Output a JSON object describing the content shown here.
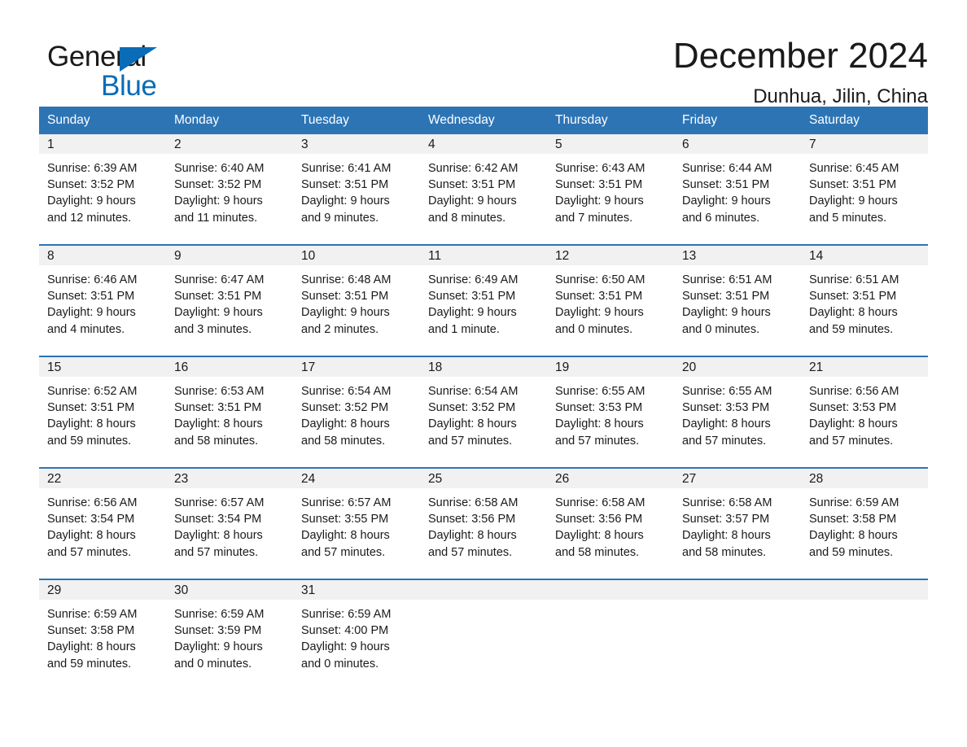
{
  "brand": {
    "name_part1": "General",
    "name_part2": "Blue",
    "logo_icon": "triangle-flag-icon",
    "accent_color": "#0a6cb6"
  },
  "header": {
    "month_title": "December 2024",
    "location": "Dunhua, Jilin, China"
  },
  "theme": {
    "header_blue": "#2d74b5",
    "daynum_band": "#f1f1f1",
    "text": "#1a1a1a"
  },
  "calendar": {
    "weekday_headers": [
      "Sunday",
      "Monday",
      "Tuesday",
      "Wednesday",
      "Thursday",
      "Friday",
      "Saturday"
    ],
    "weeks": [
      [
        {
          "day": "1",
          "sunrise": "Sunrise: 6:39 AM",
          "sunset": "Sunset: 3:52 PM",
          "daylight_line1": "Daylight: 9 hours",
          "daylight_line2": "and 12 minutes."
        },
        {
          "day": "2",
          "sunrise": "Sunrise: 6:40 AM",
          "sunset": "Sunset: 3:52 PM",
          "daylight_line1": "Daylight: 9 hours",
          "daylight_line2": "and 11 minutes."
        },
        {
          "day": "3",
          "sunrise": "Sunrise: 6:41 AM",
          "sunset": "Sunset: 3:51 PM",
          "daylight_line1": "Daylight: 9 hours",
          "daylight_line2": "and 9 minutes."
        },
        {
          "day": "4",
          "sunrise": "Sunrise: 6:42 AM",
          "sunset": "Sunset: 3:51 PM",
          "daylight_line1": "Daylight: 9 hours",
          "daylight_line2": "and 8 minutes."
        },
        {
          "day": "5",
          "sunrise": "Sunrise: 6:43 AM",
          "sunset": "Sunset: 3:51 PM",
          "daylight_line1": "Daylight: 9 hours",
          "daylight_line2": "and 7 minutes."
        },
        {
          "day": "6",
          "sunrise": "Sunrise: 6:44 AM",
          "sunset": "Sunset: 3:51 PM",
          "daylight_line1": "Daylight: 9 hours",
          "daylight_line2": "and 6 minutes."
        },
        {
          "day": "7",
          "sunrise": "Sunrise: 6:45 AM",
          "sunset": "Sunset: 3:51 PM",
          "daylight_line1": "Daylight: 9 hours",
          "daylight_line2": "and 5 minutes."
        }
      ],
      [
        {
          "day": "8",
          "sunrise": "Sunrise: 6:46 AM",
          "sunset": "Sunset: 3:51 PM",
          "daylight_line1": "Daylight: 9 hours",
          "daylight_line2": "and 4 minutes."
        },
        {
          "day": "9",
          "sunrise": "Sunrise: 6:47 AM",
          "sunset": "Sunset: 3:51 PM",
          "daylight_line1": "Daylight: 9 hours",
          "daylight_line2": "and 3 minutes."
        },
        {
          "day": "10",
          "sunrise": "Sunrise: 6:48 AM",
          "sunset": "Sunset: 3:51 PM",
          "daylight_line1": "Daylight: 9 hours",
          "daylight_line2": "and 2 minutes."
        },
        {
          "day": "11",
          "sunrise": "Sunrise: 6:49 AM",
          "sunset": "Sunset: 3:51 PM",
          "daylight_line1": "Daylight: 9 hours",
          "daylight_line2": "and 1 minute."
        },
        {
          "day": "12",
          "sunrise": "Sunrise: 6:50 AM",
          "sunset": "Sunset: 3:51 PM",
          "daylight_line1": "Daylight: 9 hours",
          "daylight_line2": "and 0 minutes."
        },
        {
          "day": "13",
          "sunrise": "Sunrise: 6:51 AM",
          "sunset": "Sunset: 3:51 PM",
          "daylight_line1": "Daylight: 9 hours",
          "daylight_line2": "and 0 minutes."
        },
        {
          "day": "14",
          "sunrise": "Sunrise: 6:51 AM",
          "sunset": "Sunset: 3:51 PM",
          "daylight_line1": "Daylight: 8 hours",
          "daylight_line2": "and 59 minutes."
        }
      ],
      [
        {
          "day": "15",
          "sunrise": "Sunrise: 6:52 AM",
          "sunset": "Sunset: 3:51 PM",
          "daylight_line1": "Daylight: 8 hours",
          "daylight_line2": "and 59 minutes."
        },
        {
          "day": "16",
          "sunrise": "Sunrise: 6:53 AM",
          "sunset": "Sunset: 3:51 PM",
          "daylight_line1": "Daylight: 8 hours",
          "daylight_line2": "and 58 minutes."
        },
        {
          "day": "17",
          "sunrise": "Sunrise: 6:54 AM",
          "sunset": "Sunset: 3:52 PM",
          "daylight_line1": "Daylight: 8 hours",
          "daylight_line2": "and 58 minutes."
        },
        {
          "day": "18",
          "sunrise": "Sunrise: 6:54 AM",
          "sunset": "Sunset: 3:52 PM",
          "daylight_line1": "Daylight: 8 hours",
          "daylight_line2": "and 57 minutes."
        },
        {
          "day": "19",
          "sunrise": "Sunrise: 6:55 AM",
          "sunset": "Sunset: 3:53 PM",
          "daylight_line1": "Daylight: 8 hours",
          "daylight_line2": "and 57 minutes."
        },
        {
          "day": "20",
          "sunrise": "Sunrise: 6:55 AM",
          "sunset": "Sunset: 3:53 PM",
          "daylight_line1": "Daylight: 8 hours",
          "daylight_line2": "and 57 minutes."
        },
        {
          "day": "21",
          "sunrise": "Sunrise: 6:56 AM",
          "sunset": "Sunset: 3:53 PM",
          "daylight_line1": "Daylight: 8 hours",
          "daylight_line2": "and 57 minutes."
        }
      ],
      [
        {
          "day": "22",
          "sunrise": "Sunrise: 6:56 AM",
          "sunset": "Sunset: 3:54 PM",
          "daylight_line1": "Daylight: 8 hours",
          "daylight_line2": "and 57 minutes."
        },
        {
          "day": "23",
          "sunrise": "Sunrise: 6:57 AM",
          "sunset": "Sunset: 3:54 PM",
          "daylight_line1": "Daylight: 8 hours",
          "daylight_line2": "and 57 minutes."
        },
        {
          "day": "24",
          "sunrise": "Sunrise: 6:57 AM",
          "sunset": "Sunset: 3:55 PM",
          "daylight_line1": "Daylight: 8 hours",
          "daylight_line2": "and 57 minutes."
        },
        {
          "day": "25",
          "sunrise": "Sunrise: 6:58 AM",
          "sunset": "Sunset: 3:56 PM",
          "daylight_line1": "Daylight: 8 hours",
          "daylight_line2": "and 57 minutes."
        },
        {
          "day": "26",
          "sunrise": "Sunrise: 6:58 AM",
          "sunset": "Sunset: 3:56 PM",
          "daylight_line1": "Daylight: 8 hours",
          "daylight_line2": "and 58 minutes."
        },
        {
          "day": "27",
          "sunrise": "Sunrise: 6:58 AM",
          "sunset": "Sunset: 3:57 PM",
          "daylight_line1": "Daylight: 8 hours",
          "daylight_line2": "and 58 minutes."
        },
        {
          "day": "28",
          "sunrise": "Sunrise: 6:59 AM",
          "sunset": "Sunset: 3:58 PM",
          "daylight_line1": "Daylight: 8 hours",
          "daylight_line2": "and 59 minutes."
        }
      ],
      [
        {
          "day": "29",
          "sunrise": "Sunrise: 6:59 AM",
          "sunset": "Sunset: 3:58 PM",
          "daylight_line1": "Daylight: 8 hours",
          "daylight_line2": "and 59 minutes."
        },
        {
          "day": "30",
          "sunrise": "Sunrise: 6:59 AM",
          "sunset": "Sunset: 3:59 PM",
          "daylight_line1": "Daylight: 9 hours",
          "daylight_line2": "and 0 minutes."
        },
        {
          "day": "31",
          "sunrise": "Sunrise: 6:59 AM",
          "sunset": "Sunset: 4:00 PM",
          "daylight_line1": "Daylight: 9 hours",
          "daylight_line2": "and 0 minutes."
        },
        {
          "day": "",
          "sunrise": "",
          "sunset": "",
          "daylight_line1": "",
          "daylight_line2": ""
        },
        {
          "day": "",
          "sunrise": "",
          "sunset": "",
          "daylight_line1": "",
          "daylight_line2": ""
        },
        {
          "day": "",
          "sunrise": "",
          "sunset": "",
          "daylight_line1": "",
          "daylight_line2": ""
        },
        {
          "day": "",
          "sunrise": "",
          "sunset": "",
          "daylight_line1": "",
          "daylight_line2": ""
        }
      ]
    ]
  }
}
